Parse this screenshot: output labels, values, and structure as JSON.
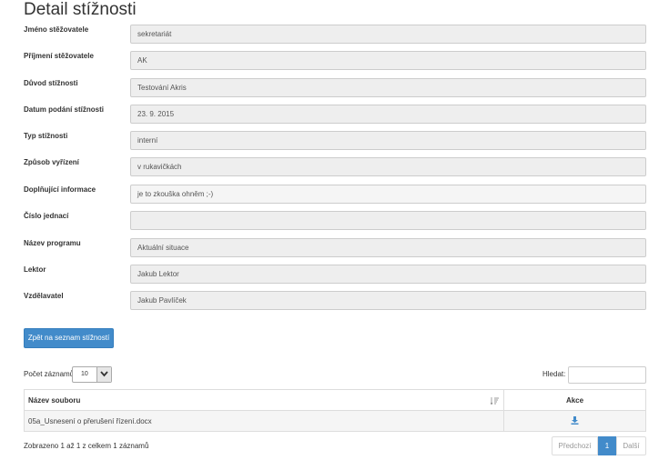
{
  "page": {
    "title": "Detail stížnosti"
  },
  "fields": [
    {
      "label": "Jméno stěžovatele",
      "value": "sekretariát"
    },
    {
      "label": "Příjmení stěžovatele",
      "value": "AK"
    },
    {
      "label": "Důvod stížnosti",
      "value": "Testování Akris"
    },
    {
      "label": "Datum podání stížnosti",
      "value": "23. 9. 2015"
    },
    {
      "label": "Typ stížnosti",
      "value": "interní"
    },
    {
      "label": "Způsob vyřízení",
      "value": "v rukavičkách"
    },
    {
      "label": "Doplňující informace",
      "value": "je to zkouška ohněm ;-)"
    },
    {
      "label": "Číslo jednací",
      "value": ""
    },
    {
      "label": "Název programu",
      "value": "Aktuální situace"
    },
    {
      "label": "Lektor",
      "value": "Jakub Lektor"
    },
    {
      "label": "Vzdělavatel",
      "value": "Jakub Pavlíček"
    }
  ],
  "back_button": "Zpět na seznam stížností",
  "table_controls": {
    "length_label": "Počet záznamů",
    "length_value": "10",
    "search_label": "Hledat:"
  },
  "table": {
    "headers": [
      "Název souboru",
      "Akce"
    ],
    "rows": [
      {
        "file": "05a_Usnesení o přerušení řízení.docx",
        "action_icon": "download-icon"
      }
    ]
  },
  "info": "Zobrazeno 1 až 1 z celkem 1 záznamů",
  "pagination": {
    "prev": "Předchozí",
    "current": "1",
    "next": "Další"
  },
  "colors": {
    "primary": "#428bca",
    "field_bg": "#eeeeee"
  }
}
